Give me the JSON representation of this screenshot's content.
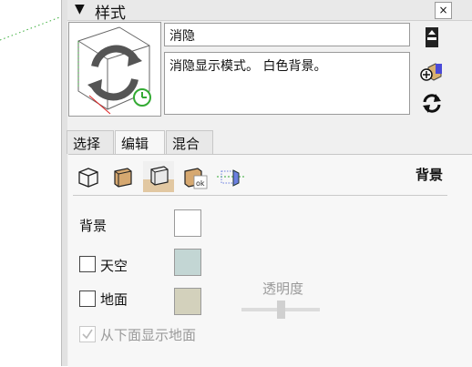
{
  "panel": {
    "title": "样式",
    "collapse_glyph": "▼",
    "close_glyph": "×",
    "thumbnail_icon": "style-thumbnail-icon"
  },
  "style": {
    "name": "消隐",
    "description": "消隐显示模式。 白色背景。"
  },
  "side_buttons": [
    "toggle-secondary-pane-icon",
    "create-style-icon",
    "update-style-icon"
  ],
  "tabs": [
    {
      "label": "选择",
      "active": false
    },
    {
      "label": "编辑",
      "active": true
    },
    {
      "label": "混合",
      "active": false
    }
  ],
  "edit_toolbar": {
    "tools": [
      "edge-settings-icon",
      "face-settings-icon",
      "background-settings-icon",
      "watermark-settings-icon",
      "modeling-settings-icon"
    ],
    "active_tool": "background-settings-icon",
    "section_label": "背景"
  },
  "background": {
    "background_label": "背景",
    "background_color": "#ffffff",
    "sky_label": "天空",
    "sky_checked": false,
    "sky_color": "#c3d6d4",
    "ground_label": "地面",
    "ground_checked": false,
    "ground_color": "#d3d1bc",
    "transparency_label": "透明度",
    "show_ground_below_label": "从下面显示地面",
    "show_ground_below_checked": true
  }
}
